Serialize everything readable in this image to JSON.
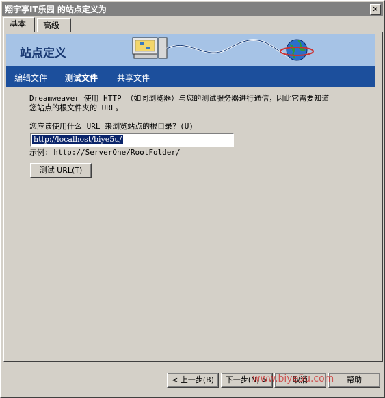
{
  "window": {
    "title": "翔宇亭IT乐园 的站点定义为",
    "close_glyph": "✕"
  },
  "tabs": [
    {
      "label": "基本",
      "active": true
    },
    {
      "label": "高级",
      "active": false
    }
  ],
  "banner": {
    "title": "站点定义"
  },
  "nav": [
    {
      "label": "编辑文件",
      "current": false
    },
    {
      "label": "测试文件",
      "current": true
    },
    {
      "label": "共享文件",
      "current": false
    }
  ],
  "content": {
    "desc_line1": "Dreamweaver 使用 HTTP （如同浏览器）与您的测试服务器进行通信，因此它需要知道",
    "desc_line2": "您站点的根文件夹的 URL。",
    "question": "您应该使用什么 URL 来浏览站点的根目录？(U)",
    "url_value": "http://localhost/biye5u/",
    "example": "示例: http://ServerOne/RootFolder/",
    "test_button": "测试 URL(T)"
  },
  "footer": {
    "back_button": "< 上一步(B)",
    "next_button": "下一步(N) >",
    "cancel_button": "取消",
    "help_button": "帮助",
    "watermark": "www.biye5u.com"
  },
  "colors": {
    "banner_bg": "#a6c3e6",
    "nav_bg": "#1c4f9c",
    "selection": "#0a246a"
  }
}
